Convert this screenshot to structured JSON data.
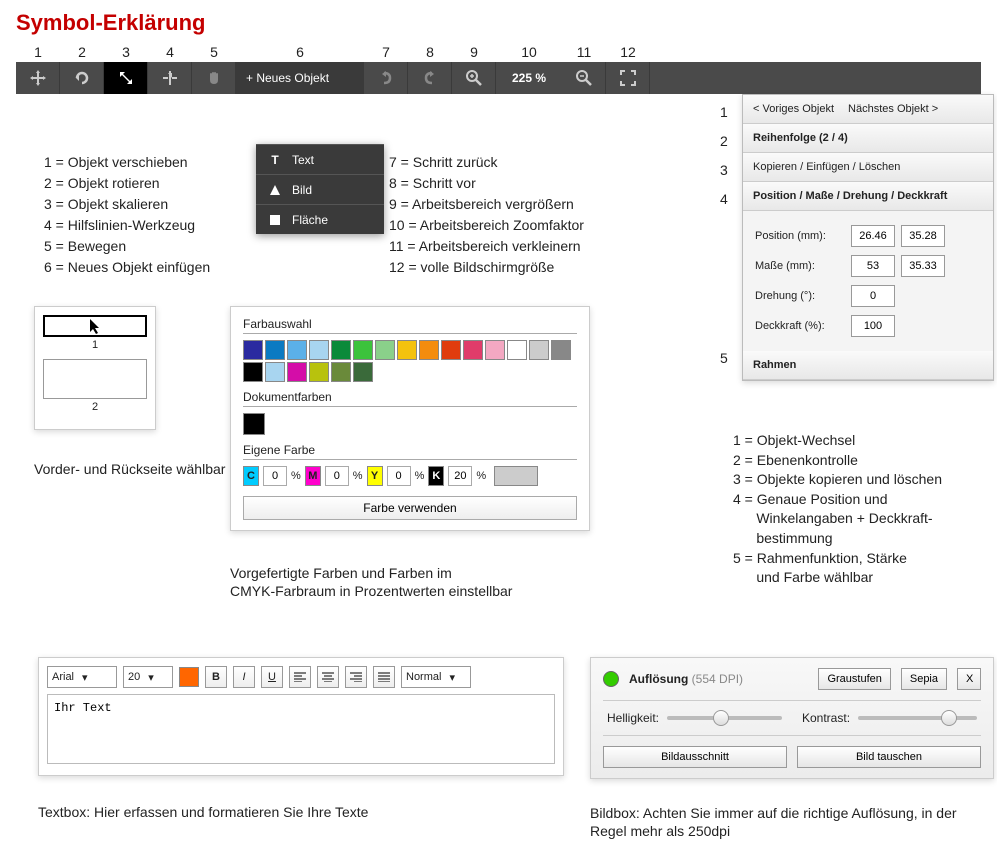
{
  "title": "Symbol-Erklärung",
  "toolbar": {
    "nums": [
      "1",
      "2",
      "3",
      "4",
      "5",
      "6",
      "7",
      "8",
      "9",
      "10",
      "11",
      "12"
    ],
    "new_label": "+ Neues Objekt",
    "zoom": "225 %",
    "menu": {
      "text": "Text",
      "bild": "Bild",
      "flaeche": "Fläche"
    }
  },
  "legend_left": [
    "1 = Objekt verschieben",
    "2 = Objekt rotieren",
    "3 = Objekt skalieren",
    "4 = Hilfslinien-Werkzeug",
    "5 = Bewegen",
    "6 = Neues Objekt einfügen"
  ],
  "legend_right": [
    "7 = Schritt zurück",
    "8 = Schritt vor",
    "9 = Arbeitsbereich vergrößern",
    "10 = Arbeitsbereich Zoomfaktor",
    "11 = Arbeitsbereich verkleinern",
    "12 = volle Bildschirmgröße"
  ],
  "thumbs": {
    "p1": "1",
    "p2": "2",
    "caption": "Vorder- und Rückseite wählbar"
  },
  "colors": {
    "head1": "Farbauswahl",
    "head2": "Dokumentfarben",
    "head3": "Eigene Farbe",
    "use": "Farbe verwenden",
    "caption": "Vorgefertigte Farben und Farben im\nCMYK-Farbraum in Prozentwerten einstellbar",
    "swatches": [
      "#2a2aa0",
      "#0a7ac2",
      "#5bb0e8",
      "#a8d5f0",
      "#0a8a3a",
      "#3cc33c",
      "#8ad08a",
      "#f4c20d",
      "#f48c0d",
      "#e03c0d",
      "#e03c6a",
      "#f4a8c2",
      "#ffffff",
      "#cccccc",
      "#888888",
      "#000000",
      "#a8d5f0",
      "#d40da8",
      "#b8c20d",
      "#6a8a3a",
      "#3a6a3a"
    ],
    "doc_swatch": "#000000",
    "cmyk": {
      "c": "0",
      "m": "0",
      "y": "0",
      "k": "20"
    }
  },
  "right_panel": {
    "prev": "< Voriges Objekt",
    "next": "Nächstes Objekt >",
    "order": "Reihenfolge (2 / 4)",
    "copy": "Kopieren / Einfügen / Löschen",
    "posline": "Position / Maße / Drehung / Deckkraft",
    "pos_label": "Position (mm):",
    "masse_label": "Maße (mm):",
    "dreh_label": "Drehung (°):",
    "deck_label": "Deckkraft (%):",
    "pos_x": "26.46",
    "pos_y": "35.28",
    "masse_w": "53",
    "masse_h": "35.33",
    "drehung": "0",
    "deckkraft": "100",
    "rahmen": "Rahmen",
    "nums": [
      "1",
      "2",
      "3",
      "4",
      "5"
    ]
  },
  "right_legend": [
    "1 = Objekt-Wechsel",
    "2 = Ebenenkontrolle",
    "3 = Objekte kopieren und löschen",
    "4 = Genaue Position und",
    "      Winkelangaben + Deckkraft-",
    "      bestimmung",
    "5 = Rahmenfunktion, Stärke",
    "      und Farbe wählbar"
  ],
  "textbox": {
    "font": "Arial",
    "size": "20",
    "style": "Normal",
    "content": "Ihr Text",
    "color": "#ff6600",
    "caption": "Textbox: Hier erfassen und formatieren Sie Ihre Texte"
  },
  "bildbox": {
    "res_label": "Auflösung",
    "res_value": "(554 DPI)",
    "grau": "Graustufen",
    "sepia": "Sepia",
    "close": "X",
    "hell": "Helligkeit:",
    "kontrast": "Kontrast:",
    "crop": "Bildausschnitt",
    "swap": "Bild tauschen",
    "caption": "Bildbox: Achten Sie immer auf die richtige Auflösung, in der Regel mehr als 250dpi"
  }
}
